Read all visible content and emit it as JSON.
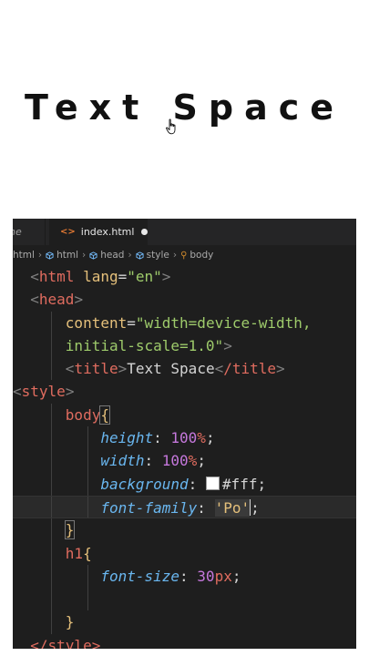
{
  "preview": {
    "heading": "Text Space"
  },
  "editor": {
    "tabs": [
      {
        "label": "ne",
        "active": false
      },
      {
        "label": "index.html",
        "active": true,
        "modified": true
      }
    ],
    "breadcrumbs": [
      "html",
      "html",
      "head",
      "style",
      "body"
    ],
    "code": {
      "l1_tag": "html",
      "l1_attr": "lang",
      "l1_eq": "=",
      "l1_val": "\"en\"",
      "l2_tag": "head",
      "l3_attr": "content",
      "l3_eq": "=",
      "l3_val": "\"width=device-width,",
      "l4_val": "initial-scale=1.0\"",
      "l5_open": "title",
      "l5_text": "Text Space",
      "l5_close": "/title",
      "l6_tag": "style",
      "l7_sel": "body",
      "l7_brace": "{",
      "l8_prop": "height",
      "l8_num": "100",
      "l8_unit": "%",
      "l9_prop": "width",
      "l9_num": "100",
      "l9_unit": "%",
      "l10_prop": "background",
      "l10_val": "#fff",
      "l11_prop": "font-family",
      "l11_val": "'Po'",
      "l12_brace": "}",
      "l13_sel": "h1",
      "l13_brace": "{",
      "l14_prop": "font-size",
      "l14_num": "30",
      "l14_unit": "px",
      "l16_brace": "}",
      "l17_text": "</style>"
    }
  },
  "colors": {
    "editor_bg": "#1e1e1e",
    "tabbar_bg": "#252526",
    "tag": "#e06c5f",
    "attribute": "#e5c07b",
    "string": "#9ecb6b",
    "property": "#6ab7f0",
    "number": "#c678dd"
  },
  "icons": [
    "html-file-icon",
    "cube-icon",
    "tag-icon",
    "hand-pointer-icon"
  ]
}
